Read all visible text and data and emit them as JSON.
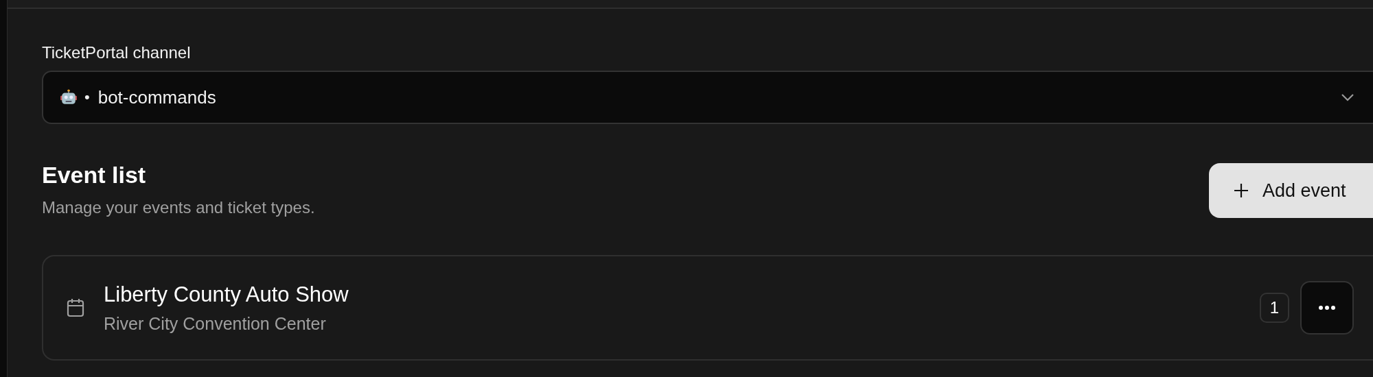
{
  "channel_field": {
    "label": "TicketPortal channel",
    "separator": "•",
    "value": "bot-commands"
  },
  "event_section": {
    "title": "Event list",
    "subtitle": "Manage your events and ticket types.",
    "add_button": "Add event"
  },
  "events": [
    {
      "name": "Liberty County Auto Show",
      "venue": "River City Convention Center",
      "count": "1"
    }
  ]
}
